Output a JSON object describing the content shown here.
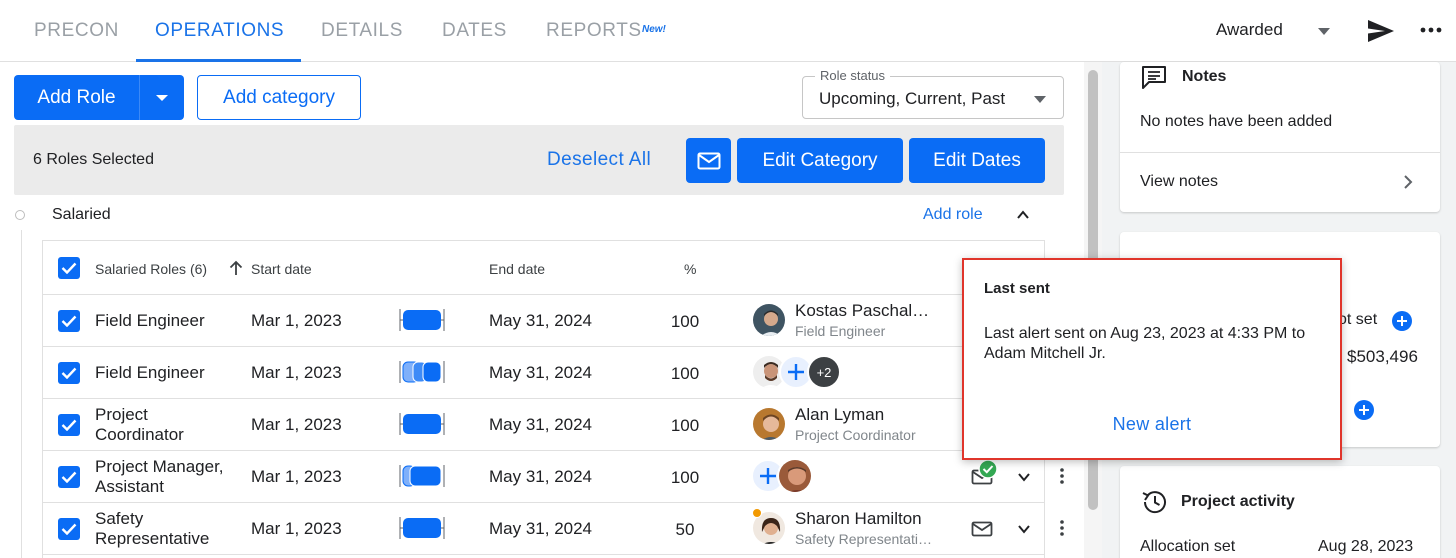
{
  "tabs": [
    {
      "label": "PRECON",
      "active": false
    },
    {
      "label": "OPERATIONS",
      "active": true
    },
    {
      "label": "DETAILS",
      "active": false
    },
    {
      "label": "DATES",
      "active": false
    },
    {
      "label": "REPORTS",
      "active": false
    }
  ],
  "reports_badge": "New!",
  "project_status": "Awarded",
  "toolbar": {
    "add_role_label": "Add Role",
    "add_category_label": "Add category",
    "role_status_label": "Role status",
    "role_status_value": "Upcoming, Current, Past"
  },
  "selection_bar": {
    "selected_text": "6 Roles Selected",
    "deselect_label": "Deselect All",
    "edit_category_label": "Edit Category",
    "edit_dates_label": "Edit Dates"
  },
  "category": {
    "name": "Salaried",
    "add_role_label": "Add role"
  },
  "table": {
    "headers": {
      "roles": "Salaried Roles (6)",
      "start": "Start date",
      "end": "End date",
      "pct": "%"
    },
    "rows": [
      {
        "role": "Field Engineer",
        "start": "Mar 1, 2023",
        "end": "May 31, 2024",
        "pct": "100",
        "person_name": "Kostas Paschal…",
        "person_role": "Field Engineer"
      },
      {
        "role": "Field Engineer",
        "start": "Mar 1, 2023",
        "end": "May 31, 2024",
        "pct": "100",
        "extra_count": "+2"
      },
      {
        "role": "Project Coordinator",
        "start": "Mar 1, 2023",
        "end": "May 31, 2024",
        "pct": "100",
        "person_name": "Alan Lyman",
        "person_role": "Project Coordinator"
      },
      {
        "role": "Project Manager, Assistant",
        "start": "Mar 1, 2023",
        "end": "May 31, 2024",
        "pct": "100"
      },
      {
        "role": "Safety Representative",
        "start": "Mar 1, 2023",
        "end": "May 31, 2024",
        "pct": "50",
        "person_name": "Sharon Hamilton",
        "person_role": "Safety Representati…"
      }
    ]
  },
  "right_panel": {
    "notes_title": "Notes",
    "notes_empty": "No notes have been added",
    "view_notes": "View notes",
    "mid_partial_text": "ot set",
    "mid_amount": "$503,496",
    "activity_title": "Project activity",
    "activity_label": "Allocation set",
    "activity_date": "Aug 28, 2023"
  },
  "popover": {
    "title": "Last sent",
    "body": "Last alert sent on Aug 23, 2023 at 4:33 PM to Adam Mitchell Jr.",
    "action": "New alert"
  },
  "colors": {
    "primary": "#0a6cf5",
    "link": "#1a73e8",
    "highlight_border": "#e0352b",
    "success": "#34a853",
    "warning_dot": "#f29900"
  }
}
